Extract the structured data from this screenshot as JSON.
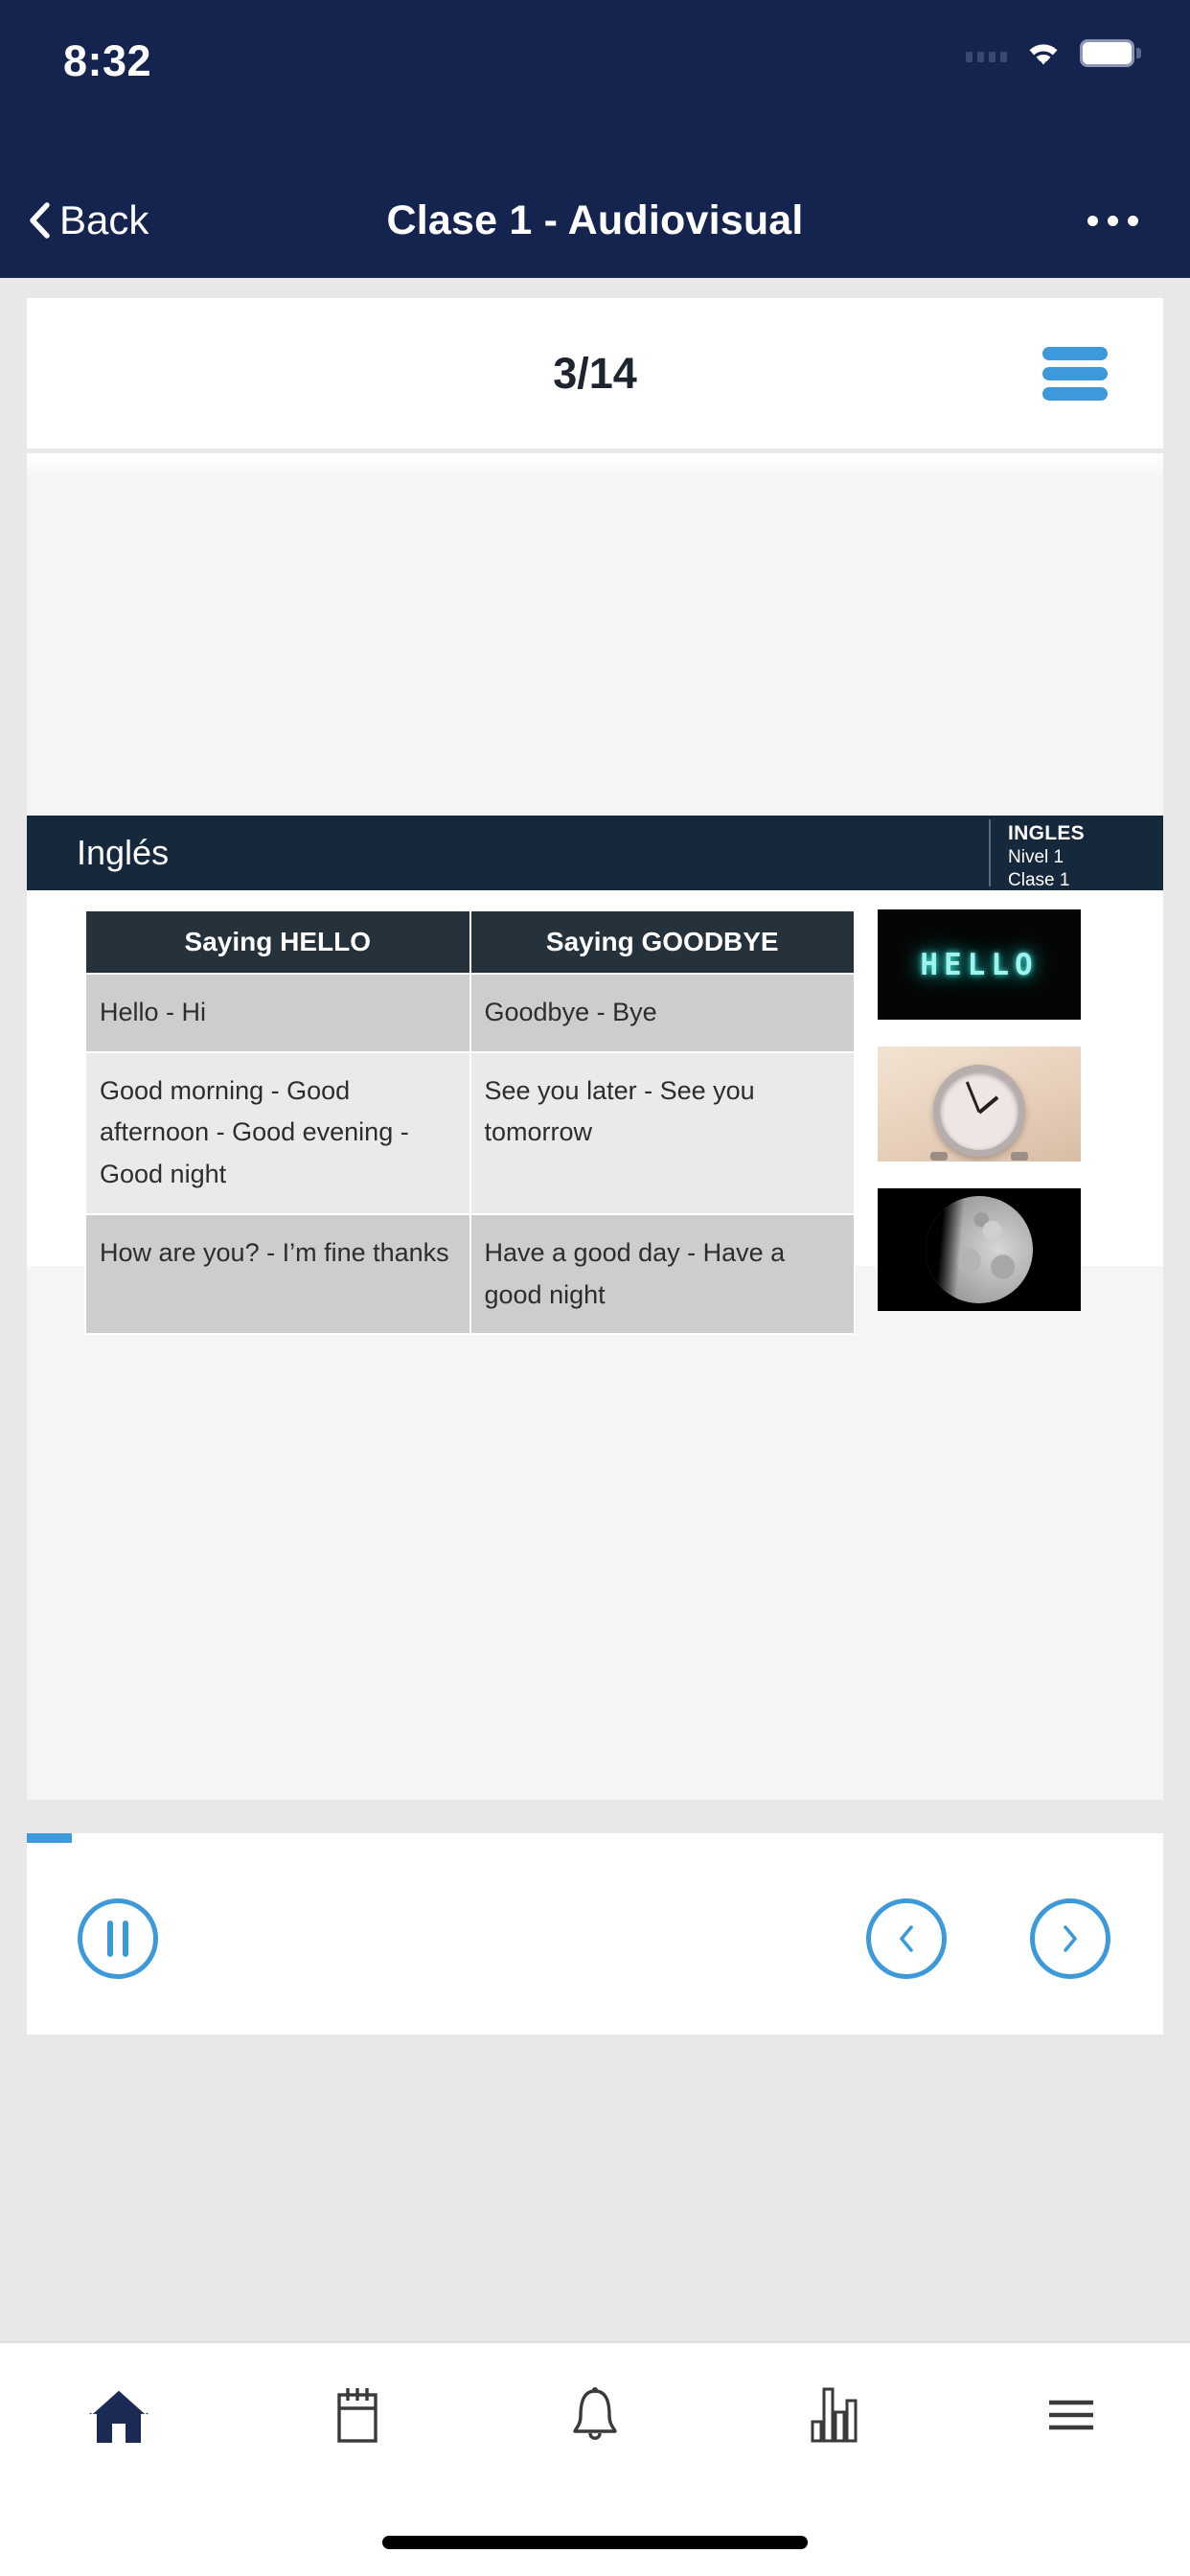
{
  "status_bar": {
    "time": "8:32",
    "signal_icon": "signal-dots-icon",
    "wifi_icon": "wifi-icon",
    "battery_icon": "battery-full-icon"
  },
  "nav_bar": {
    "back_label": "Back",
    "back_icon": "chevron-left-icon",
    "title": "Clase 1 - Audiovisual",
    "more_icon": "more-options-icon"
  },
  "page_card": {
    "counter": "3/14",
    "current_page": 3,
    "total_pages": 14,
    "menu_icon": "hamburger-menu-icon",
    "menu_color": "#3c9ada"
  },
  "slide": {
    "header": {
      "subject": "Inglés",
      "badge_title": "INGLES",
      "badge_level": "Nivel 1",
      "badge_class": "Clase 1",
      "background": "#16283c"
    },
    "table": {
      "headers": [
        "Saying HELLO",
        "Saying GOODBYE"
      ],
      "header_background": "#25323c",
      "rows": [
        [
          "Hello - Hi",
          "Goodbye - Bye"
        ],
        [
          "Good morning - Good afternoon - Good evening - Good night",
          "See you later - See you tomorrow"
        ],
        [
          "How are you? - I’m fine thanks",
          "Have a good day - Have a good night"
        ]
      ]
    },
    "images": [
      {
        "name": "hello-neon-sign-image",
        "caption": "HELLO"
      },
      {
        "name": "alarm-clock-image",
        "caption": ""
      },
      {
        "name": "moon-image",
        "caption": ""
      }
    ]
  },
  "player": {
    "progress_percent": 4,
    "progress_color": "#3c9ada",
    "pause_icon": "pause-circle-icon",
    "previous_icon": "chevron-left-circle-icon",
    "next_icon": "chevron-right-circle-icon"
  },
  "tab_bar": {
    "active_index": 0,
    "active_color": "#1b2a55",
    "inactive_color": "#3a3a3a",
    "items": [
      {
        "icon": "home-icon",
        "label": ""
      },
      {
        "icon": "calendar-icon",
        "label": ""
      },
      {
        "icon": "bell-icon",
        "label": ""
      },
      {
        "icon": "bar-chart-icon",
        "label": ""
      },
      {
        "icon": "menu-icon",
        "label": ""
      }
    ]
  }
}
